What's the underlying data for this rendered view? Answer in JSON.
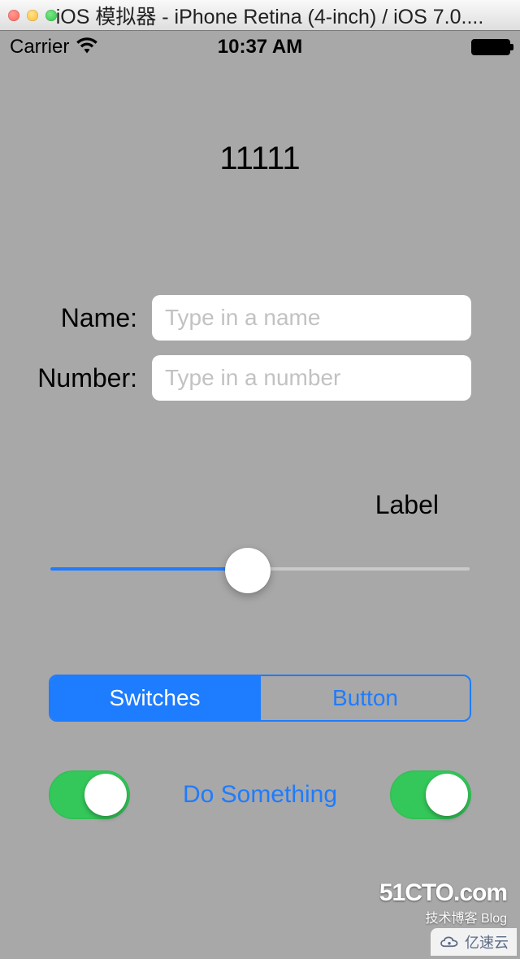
{
  "window": {
    "title": "iOS 模拟器 - iPhone Retina (4-inch) / iOS 7.0...."
  },
  "statusBar": {
    "carrier": "Carrier",
    "time": "10:37 AM"
  },
  "main": {
    "heading": "11111",
    "form": {
      "nameLabel": "Name:",
      "namePlaceholder": "Type in a name",
      "nameValue": "",
      "numberLabel": "Number:",
      "numberPlaceholder": "Type in a number",
      "numberValue": ""
    },
    "sliderLabel": "Label",
    "sliderValue": 0.47,
    "segmented": {
      "options": [
        "Switches",
        "Button"
      ],
      "selectedIndex": 0
    },
    "actionButton": "Do Something",
    "switchLeft": true,
    "switchRight": true
  },
  "watermarks": {
    "w1line1": "51CTO.com",
    "w1line2": "技术博客 Blog",
    "w2": "亿速云"
  },
  "colors": {
    "iosBlue": "#1e7cff",
    "iosGreen": "#34c759",
    "bg": "#a8a8a8"
  }
}
